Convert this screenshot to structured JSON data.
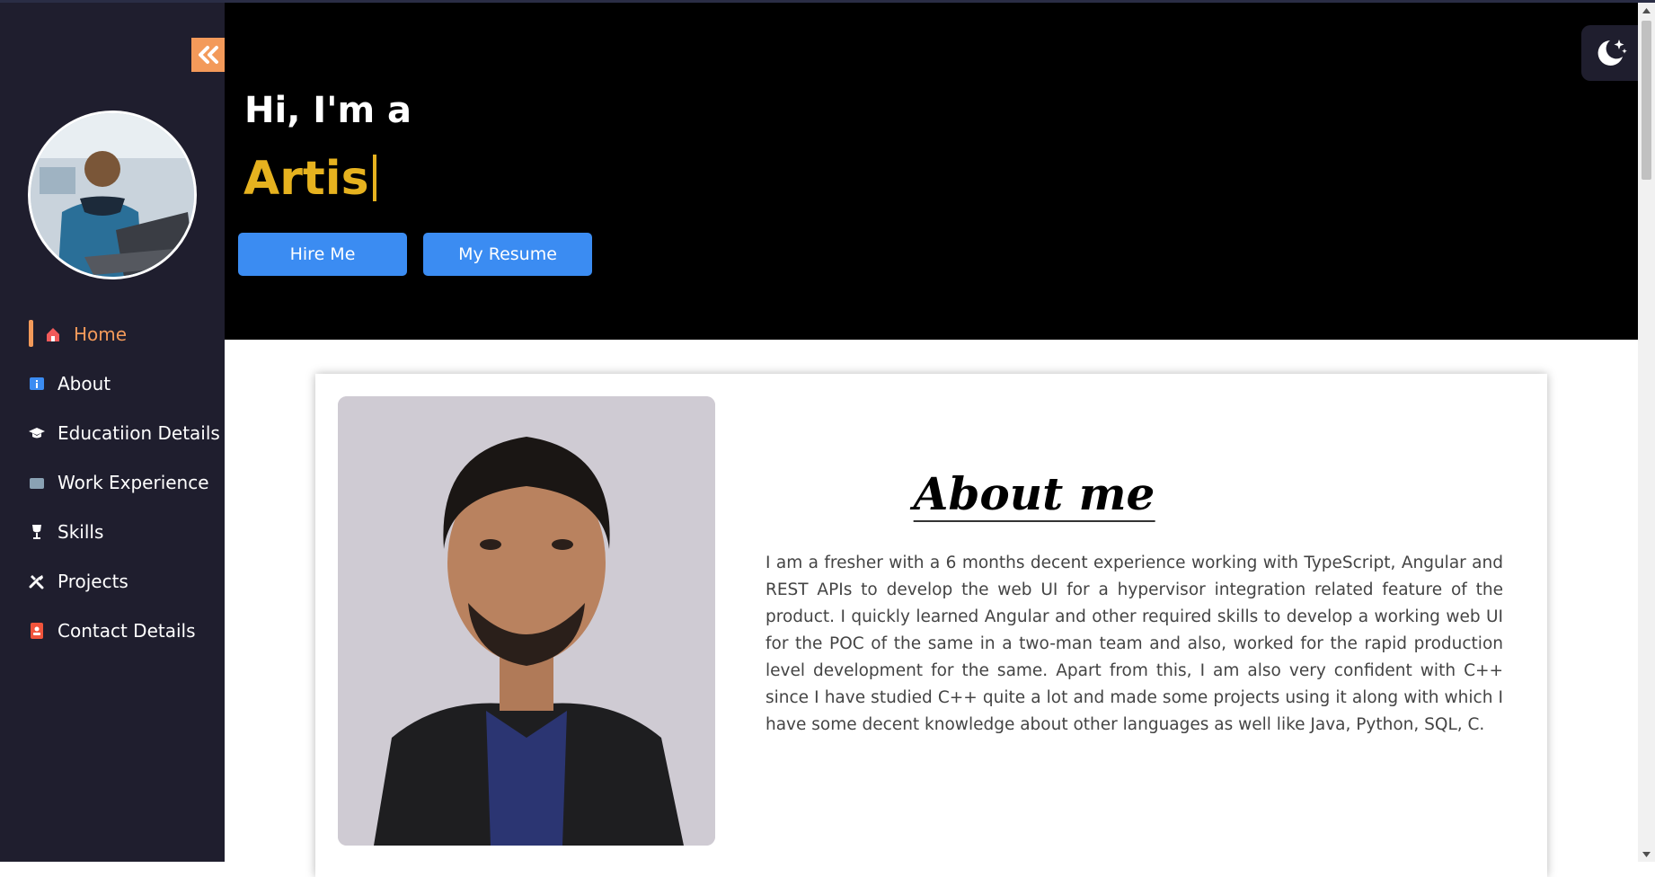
{
  "sidebar": {
    "collapse_icon": "double-chevron-left-icon",
    "items": [
      {
        "label": "Home",
        "icon": "home-icon",
        "active": true
      },
      {
        "label": "About",
        "icon": "info-icon",
        "active": false
      },
      {
        "label": "Educatiion Details",
        "icon": "graduation-cap-icon",
        "active": false
      },
      {
        "label": "Work Experience",
        "icon": "briefcase-icon",
        "active": false
      },
      {
        "label": "Skills",
        "icon": "trophy-icon",
        "active": false
      },
      {
        "label": "Projects",
        "icon": "tools-icon",
        "active": false
      },
      {
        "label": "Contact Details",
        "icon": "contact-book-icon",
        "active": false
      }
    ]
  },
  "hero": {
    "greeting": "Hi, I'm a",
    "typed_text": "Artis",
    "hire_label": "Hire Me",
    "resume_label": "My Resume"
  },
  "about": {
    "title": "About me",
    "text": "I am a fresher with a 6 months decent experience working with TypeScript, Angular and REST APIs to develop the web UI for a hypervisor integration related feature of the product. I quickly learned Angular and other required skills to develop a working web UI for the POC of the same in a two-man team and also, worked for the rapid production level development for the same. Apart from this, I am also very confident with C++ since I have studied C++ quite a lot and made some projects using it along with which I have some decent knowledge about other languages as well like Java, Python, SQL, C."
  },
  "theme_toggle_icon": "moon-stars-icon",
  "colors": {
    "sidebar_bg": "#1f1e2e",
    "accent_orange": "#f39a5a",
    "typed_yellow": "#e6b21f",
    "button_blue": "#3b8cf2",
    "hero_bg": "#000000"
  }
}
